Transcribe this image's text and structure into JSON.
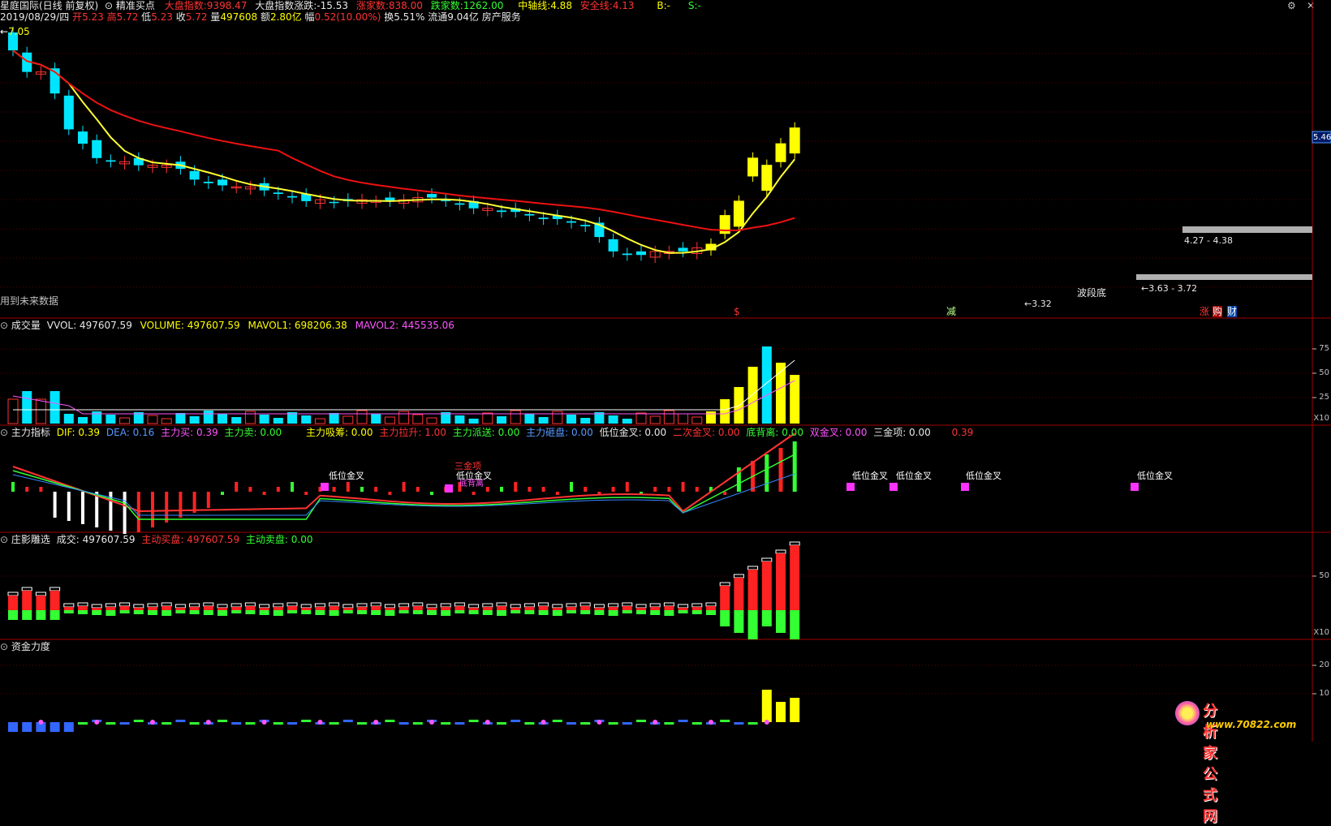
{
  "header": {
    "stock": "星庭国际(日线 前复权)",
    "indicator": "精准买点",
    "index_label": "大盘指数:",
    "index_value": "9398.47",
    "index_chg_label": "大盘指数涨跌:",
    "index_chg_value": "-15.53",
    "up_label": "涨家数:",
    "up_value": "838.00",
    "down_label": "跌家数:",
    "down_value": "1262.00",
    "mid_label": "中轴线:",
    "mid_value": "4.88",
    "safe_label": "安全线:",
    "safe_value": "4.13",
    "b_label": "B:",
    "b_value": "-",
    "s_label": "S:",
    "s_value": "-"
  },
  "quote": {
    "date": "2019/08/29/四",
    "open_label": "开",
    "open": "5.23",
    "high_label": "高",
    "high": "5.72",
    "low_label": "低",
    "low": "5.23",
    "close_label": "收",
    "close": "5.72",
    "vol_label": "量",
    "vol": "497608",
    "amt_label": "额",
    "amt": "2.80亿",
    "chg_label": "幅",
    "chg": "0.52(10.00%)",
    "turn_label": "换",
    "turn": "5.51%",
    "float_label": "流通",
    "float": "9.04亿",
    "sector": "房产服务"
  },
  "main_panel": {
    "max_label": "7.05",
    "right_tag": "5.46",
    "future_data": "用到未来数据",
    "low_mark": "3.32",
    "bottom_label": "波段底",
    "range1": "4.27 - 4.38",
    "range2": "3.63 - 3.72",
    "marker_s": "$",
    "marker_jian": "减",
    "marker_zhang": "涨",
    "marker_gou": "购",
    "marker_cai": "财"
  },
  "volume_panel": {
    "name": "成交量",
    "vol_label": "VVOL: 497607.59",
    "volume_label": "VOLUME: 497607.59",
    "mavol1_label": "MAVOL1: 698206.38",
    "mavol2_label": "MAVOL2: 445535.06",
    "axis": [
      "75",
      "50",
      "25",
      "X10"
    ]
  },
  "mf_panel": {
    "name": "主力指标",
    "dif": "DIF: 0.39",
    "dea": "DEA: 0.16",
    "zlm": "主力买: 0.39",
    "zlmc": "主力卖: 0.00",
    "xc": "主力吸筹: 0.00",
    "ls": "主力拉升: 1.00",
    "px": "主力派送: 0.00",
    "zp": "主力砸盘: 0.00",
    "dwjc": "低位金叉: 0.00",
    "ecjc": "二次金叉: 0.00",
    "dbl": "底背离: 0.00",
    "sjc": "双金叉: 0.00",
    "sjx": "三金项: 0.00",
    "last": "0.39",
    "labels": [
      "低位金叉",
      "三金项",
      "低位金叉",
      "低位金叉",
      "低位金叉",
      "低位金叉",
      "低位金叉"
    ],
    "label_sub": "底背离"
  },
  "zy_panel": {
    "name": "庄影雕选",
    "deal": "成交: 497607.59",
    "buy": "主动买盘: 497607.59",
    "sell": "主动卖盘: 0.00",
    "axis": [
      "50",
      "X10"
    ]
  },
  "zj_panel": {
    "name": "资金力度",
    "axis": [
      "20",
      "10"
    ]
  },
  "watermark": {
    "cn": "分析家公式网",
    "url": "www.70822.com"
  },
  "chart_data": {
    "type": "candlestick",
    "title": "星庭国际(日线 前复权)",
    "price_range": [
      3.32,
      7.05
    ],
    "ohlc_close_approx": [
      6.8,
      6.5,
      6.5,
      6.2,
      5.7,
      5.5,
      5.3,
      5.25,
      5.25,
      5.2,
      5.2,
      5.2,
      5.15,
      5.0,
      4.95,
      4.92,
      4.9,
      4.9,
      4.85,
      4.8,
      4.75,
      4.7,
      4.72,
      4.68,
      4.7,
      4.72,
      4.7,
      4.7,
      4.72,
      4.75,
      4.75,
      4.7,
      4.65,
      4.6,
      4.6,
      4.55,
      4.55,
      4.5,
      4.45,
      4.45,
      4.4,
      4.35,
      4.2,
      4.0,
      3.95,
      3.95,
      4.0,
      4.0,
      4.0,
      4.05,
      4.1,
      4.5,
      4.7,
      5.3,
      5.2,
      5.5,
      5.72
    ],
    "last": {
      "date": "2019/08/29",
      "open": 5.23,
      "high": 5.72,
      "low": 5.23,
      "close": 5.72,
      "volume": 497608
    }
  }
}
